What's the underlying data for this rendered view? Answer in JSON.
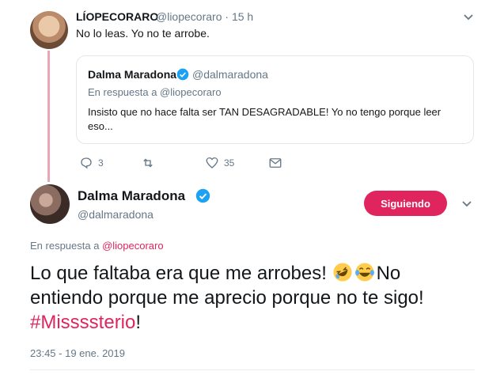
{
  "parent_tweet": {
    "name": "LÍOPECORARO",
    "handle": "@liopecoraro",
    "time": "15 h",
    "text": "No lo leas. Yo no te arrobe.",
    "quote": {
      "name": "Dalma Maradona",
      "handle": "@dalmaradona",
      "reply_to": "En respuesta a @liopecoraro",
      "text": "Insisto que no hace falta ser TAN DESAGRADABLE! Yo no tengo porque leer eso..."
    },
    "actions": {
      "replies": "3",
      "retweets": "",
      "likes": "35"
    }
  },
  "main_tweet": {
    "name": "Dalma Maradona",
    "handle": "@dalmaradona",
    "follow_label": "Siguiendo",
    "reply_prefix": "En respuesta a ",
    "reply_mention": "@liopecoraro",
    "text_part1": "Lo que faltaba era que me arrobes! ",
    "text_part2": "No entiendo porque me aprecio porque no te sigo! ",
    "hashtag": "#Missssterio",
    "text_part3": "!",
    "timestamp": "23:45 - 19 ene. 2019"
  },
  "colors": {
    "accent": "#e0245e",
    "verified": "#1da1f2",
    "muted": "#657786"
  }
}
